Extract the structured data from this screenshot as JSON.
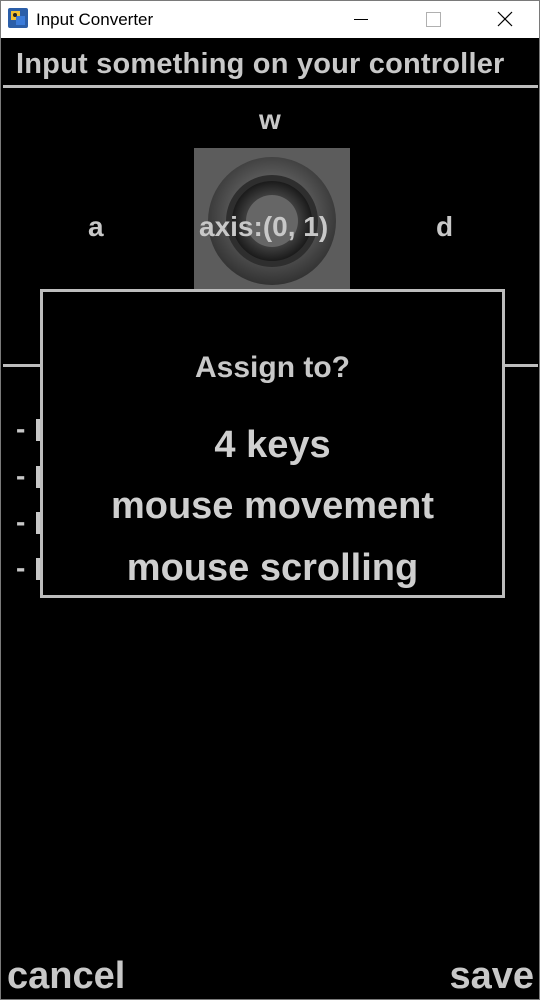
{
  "window": {
    "title": "Input Converter"
  },
  "header": {
    "prompt": "Input something on your controller"
  },
  "mapping": {
    "up": "w",
    "left": "a",
    "right": "d",
    "axis_label": "axis:(0, 1)"
  },
  "dialog": {
    "title": "Assign to?",
    "options": [
      "4 keys",
      "mouse movement",
      "mouse scrolling"
    ]
  },
  "footer": {
    "cancel": "cancel",
    "save": "save"
  },
  "colors": {
    "background": "#000000",
    "text": "#c8c8c8",
    "border": "#bdbdbd"
  }
}
